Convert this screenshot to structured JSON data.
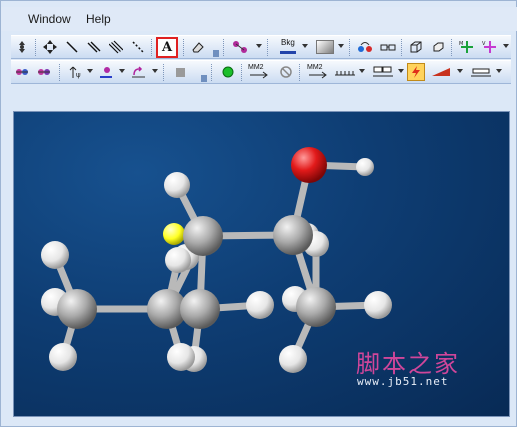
{
  "menu": {
    "window": "Window",
    "help": "Help"
  },
  "toolbar1": {
    "text_tool_label": "A",
    "background_label": "Bkg"
  },
  "toolbar2": {
    "mm2_minimize_label": "MM2",
    "mm2_dynamics_label": "MM2"
  },
  "watermark": {
    "site_name": "脚本之家",
    "url": "www.jb51.net"
  },
  "colors": {
    "viewport_background": "#0e3d73",
    "carbon": "#b8b8b8",
    "hydrogen": "#f2f2f2",
    "oxygen": "#e21a1a",
    "sulfur": "#ffff33",
    "text_tool_highlight": "#e02020"
  },
  "molecule": {
    "atoms": [
      {
        "element": "H"
      },
      {
        "element": "H"
      },
      {
        "element": "S"
      },
      {
        "element": "C"
      },
      {
        "element": "C"
      },
      {
        "element": "O"
      },
      {
        "element": "H"
      },
      {
        "element": "C"
      },
      {
        "element": "C"
      },
      {
        "element": "C"
      },
      {
        "element": "C"
      },
      {
        "element": "H"
      },
      {
        "element": "H"
      },
      {
        "element": "H"
      },
      {
        "element": "H"
      },
      {
        "element": "H"
      },
      {
        "element": "H"
      },
      {
        "element": "H"
      },
      {
        "element": "H"
      },
      {
        "element": "H"
      },
      {
        "element": "H"
      },
      {
        "element": "H"
      },
      {
        "element": "H"
      }
    ]
  }
}
